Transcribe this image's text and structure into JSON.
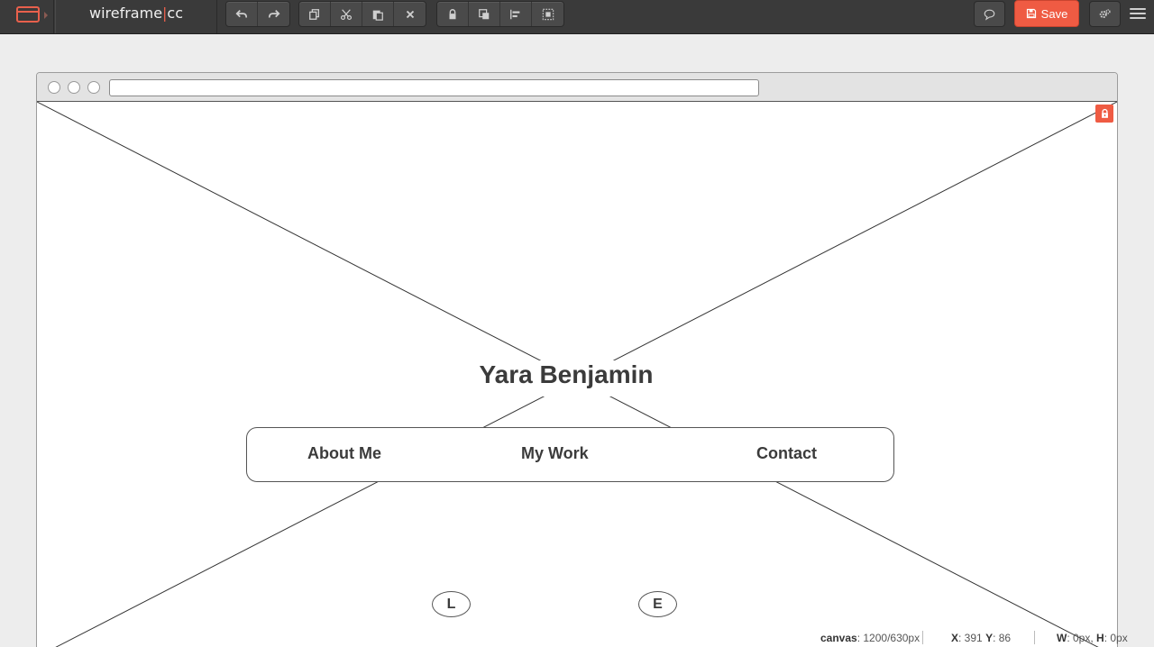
{
  "app": {
    "brand_left": "wireframe",
    "brand_sep": "|",
    "brand_right": "cc"
  },
  "toolbar": {
    "history": [
      "undo-icon",
      "redo-icon"
    ],
    "edit": [
      "duplicate-icon",
      "cut-icon",
      "paste-icon",
      "delete-icon"
    ],
    "arrange": [
      "lock-icon",
      "bring-forward-icon",
      "align-icon",
      "group-icon"
    ],
    "comment_icon": "comment-icon",
    "save_label": "Save",
    "settings_icon": "settings-icon",
    "menu_icon": "hamburger-menu-icon",
    "accent_color": "#ef5b43"
  },
  "browser": {
    "url_value": ""
  },
  "canvas": {
    "title": "Yara Benjamin",
    "nav": [
      "About Me",
      "My Work",
      "Contact"
    ],
    "circle_buttons": [
      "L",
      "E"
    ],
    "lock_badge_icon": "lock-icon"
  },
  "status": {
    "canvas_label": "canvas",
    "canvas_value": ": 1200/630px",
    "x_label": "X",
    "x_value": ": 391",
    "y_label": "Y",
    "y_value": ": 86",
    "w_label": "W",
    "w_value": ": 0px,",
    "h_label": "H",
    "h_value": ": 0px"
  }
}
